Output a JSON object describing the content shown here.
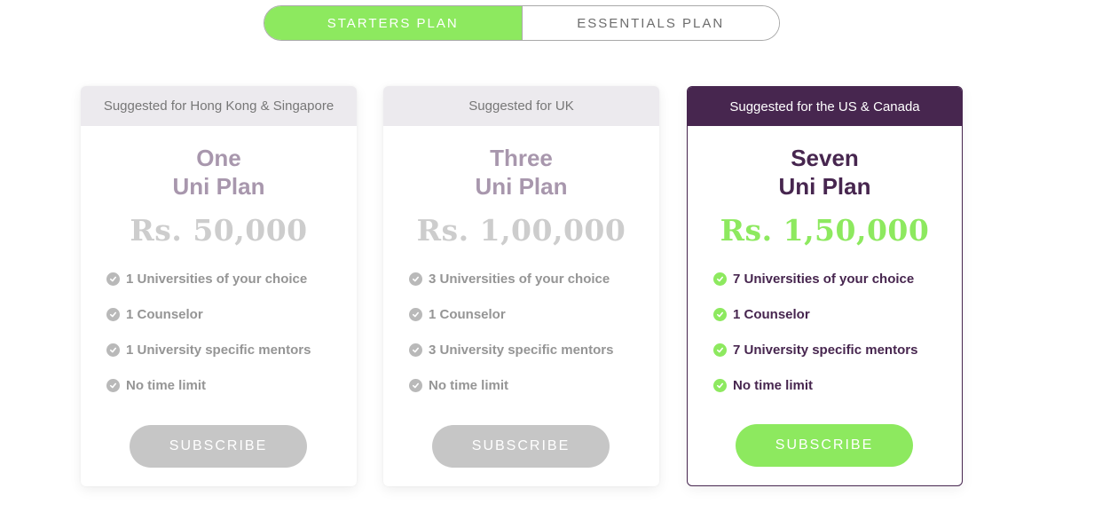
{
  "toggle": {
    "active_label": "STARTERS PLAN",
    "inactive_label": "ESSENTIALS PLAN"
  },
  "plans": [
    {
      "suggestion": "Suggested for Hong Kong & Singapore",
      "name_line1": "One",
      "name_line2": "Uni Plan",
      "price": "Rs. 50,000",
      "features": [
        "1 Universities of your choice",
        "1 Counselor",
        "1 University specific mentors",
        "No time limit"
      ],
      "button": "SUBSCRIBE"
    },
    {
      "suggestion": "Suggested for UK",
      "name_line1": "Three",
      "name_line2": "Uni Plan",
      "price": "Rs. 1,00,000",
      "features": [
        "3 Universities of your choice",
        "1 Counselor",
        "3 University specific mentors",
        "No time limit"
      ],
      "button": "SUBSCRIBE"
    },
    {
      "suggestion": "Suggested for the US & Canada",
      "name_line1": "Seven",
      "name_line2": "Uni Plan",
      "price": "Rs. 1,50,000",
      "features": [
        "7 Universities of your choice",
        "1 Counselor",
        "7 University specific mentors",
        "No time limit"
      ],
      "button": "SUBSCRIBE"
    }
  ],
  "colors": {
    "accent_green": "#8de95f",
    "brand_purple": "#47264f",
    "muted_purple": "#a897ad",
    "disabled_gray": "#c6c6c6"
  },
  "icons": {
    "feature_bullet": "check-circle-icon"
  }
}
